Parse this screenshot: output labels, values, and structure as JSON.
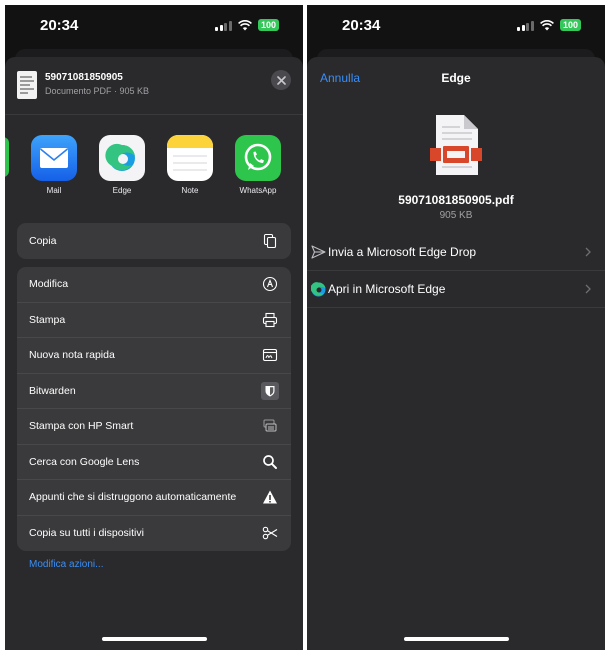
{
  "status": {
    "time": "20:34",
    "battery": "100"
  },
  "share": {
    "file_name": "59071081850905",
    "file_meta": "Documento PDF · 905 KB",
    "apps": [
      {
        "label": "Mail",
        "icon": "mail-icon"
      },
      {
        "label": "Edge",
        "icon": "edge-icon"
      },
      {
        "label": "Note",
        "icon": "notes-icon"
      },
      {
        "label": "WhatsApp",
        "icon": "whatsapp-icon"
      }
    ],
    "copy_label": "Copia",
    "actions": [
      {
        "label": "Modifica",
        "icon": "markup-icon"
      },
      {
        "label": "Stampa",
        "icon": "printer-icon"
      },
      {
        "label": "Nuova nota rapida",
        "icon": "quick-note-icon"
      },
      {
        "label": "Bitwarden",
        "icon": "bitwarden-shield-icon"
      },
      {
        "label": "Stampa con HP Smart",
        "icon": "hp-print-icon"
      },
      {
        "label": "Cerca con Google Lens",
        "icon": "search-icon"
      },
      {
        "label": "Appunti che si distruggono automaticamente",
        "icon": "warning-icon"
      },
      {
        "label": "Copia su tutti i dispositivi",
        "icon": "scissors-icon"
      }
    ],
    "edit_actions": "Modifica azioni..."
  },
  "edge_sheet": {
    "cancel": "Annulla",
    "title": "Edge",
    "file_name": "59071081850905.pdf",
    "file_size": "905 KB",
    "options": [
      {
        "label": "Invia a Microsoft Edge Drop",
        "icon": "send-icon"
      },
      {
        "label": "Apri in Microsoft Edge",
        "icon": "edge-icon"
      }
    ]
  },
  "colors": {
    "accent": "#3a8ef6",
    "sheet": "#2a2a2c",
    "group": "#3a3a3c",
    "battery": "#34c759",
    "pdf_red": "#d9472b"
  }
}
